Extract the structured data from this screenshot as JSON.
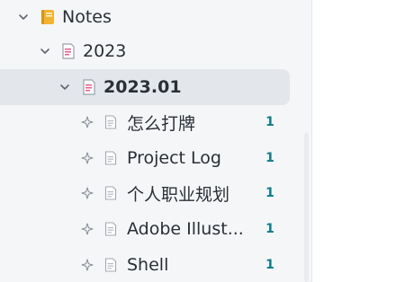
{
  "tree": {
    "root": {
      "label": "Notes",
      "icon": "notebook-icon",
      "expanded": true
    },
    "year": {
      "label": "2023",
      "icon": "document-icon",
      "expanded": true
    },
    "month": {
      "label": "2023.01",
      "icon": "document-icon",
      "expanded": true,
      "selected": true
    },
    "notes": [
      {
        "label": "怎么打牌",
        "count": "1",
        "icon": "note-icon",
        "pin_icon": "pin-icon"
      },
      {
        "label": "Project Log",
        "count": "1",
        "icon": "note-icon",
        "pin_icon": "pin-icon"
      },
      {
        "label": "个人职业规划",
        "count": "1",
        "icon": "note-icon",
        "pin_icon": "pin-icon"
      },
      {
        "label": "Adobe Illust...",
        "count": "1",
        "icon": "note-icon",
        "pin_icon": "pin-icon"
      },
      {
        "label": "Shell",
        "count": "1",
        "icon": "note-icon",
        "pin_icon": "pin-icon"
      }
    ]
  },
  "colors": {
    "panel_bg": "#f5f6f8",
    "selected_bg": "#e3e6ea",
    "count": "#0f7b8a",
    "notebook": "#f2b233",
    "document_accent": "#e35d8c"
  }
}
